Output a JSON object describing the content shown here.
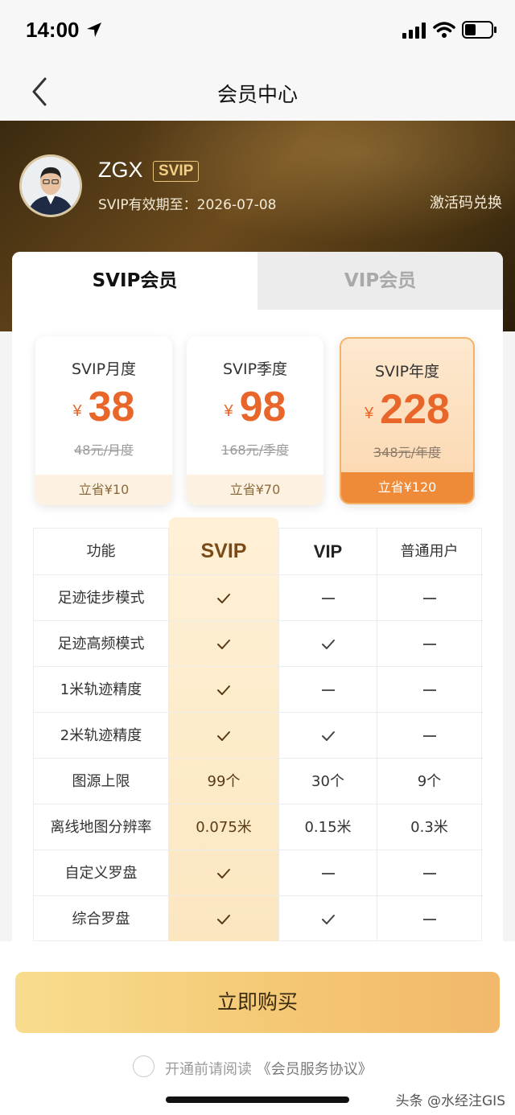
{
  "status": {
    "time": "14:00"
  },
  "nav": {
    "title": "会员中心"
  },
  "profile": {
    "username": "ZGX",
    "badge": "SVIP",
    "expire": "SVIP有效期至：2026-07-08",
    "redeem": "激活码兑换"
  },
  "tabs": [
    {
      "label": "SVIP会员",
      "active": true
    },
    {
      "label": "VIP会员",
      "active": false
    }
  ],
  "plans": [
    {
      "name": "SVIP月度",
      "currency": "¥",
      "price": "38",
      "original": "48元/月度",
      "save": "立省¥10"
    },
    {
      "name": "SVIP季度",
      "currency": "¥",
      "price": "98",
      "original": "168元/季度",
      "save": "立省¥70"
    },
    {
      "name": "SVIP年度",
      "currency": "¥",
      "price": "228",
      "original": "348元/年度",
      "save": "立省¥120",
      "selected": true
    }
  ],
  "table": {
    "headers": [
      "功能",
      "SVIP",
      "VIP",
      "普通用户"
    ],
    "rows": [
      [
        "足迹徒步模式",
        "check",
        "dash",
        "dash"
      ],
      [
        "足迹高频模式",
        "check",
        "check",
        "dash"
      ],
      [
        "1米轨迹精度",
        "check",
        "dash",
        "dash"
      ],
      [
        "2米轨迹精度",
        "check",
        "check",
        "dash"
      ],
      [
        "图源上限",
        "99个",
        "30个",
        "9个"
      ],
      [
        "离线地图分辨率",
        "0.075米",
        "0.15米",
        "0.3米"
      ],
      [
        "自定义罗盘",
        "check",
        "dash",
        "dash"
      ],
      [
        "综合罗盘",
        "check",
        "check",
        "dash"
      ]
    ]
  },
  "buy": {
    "label": "立即购买"
  },
  "agreement": {
    "prefix": "开通前请阅读",
    "link": "《会员服务协议》"
  },
  "watermark": "头条 @水经注GIS",
  "colors": {
    "accent": "#e8662a",
    "gold": "#f4c672",
    "hero": "#4a3412"
  }
}
